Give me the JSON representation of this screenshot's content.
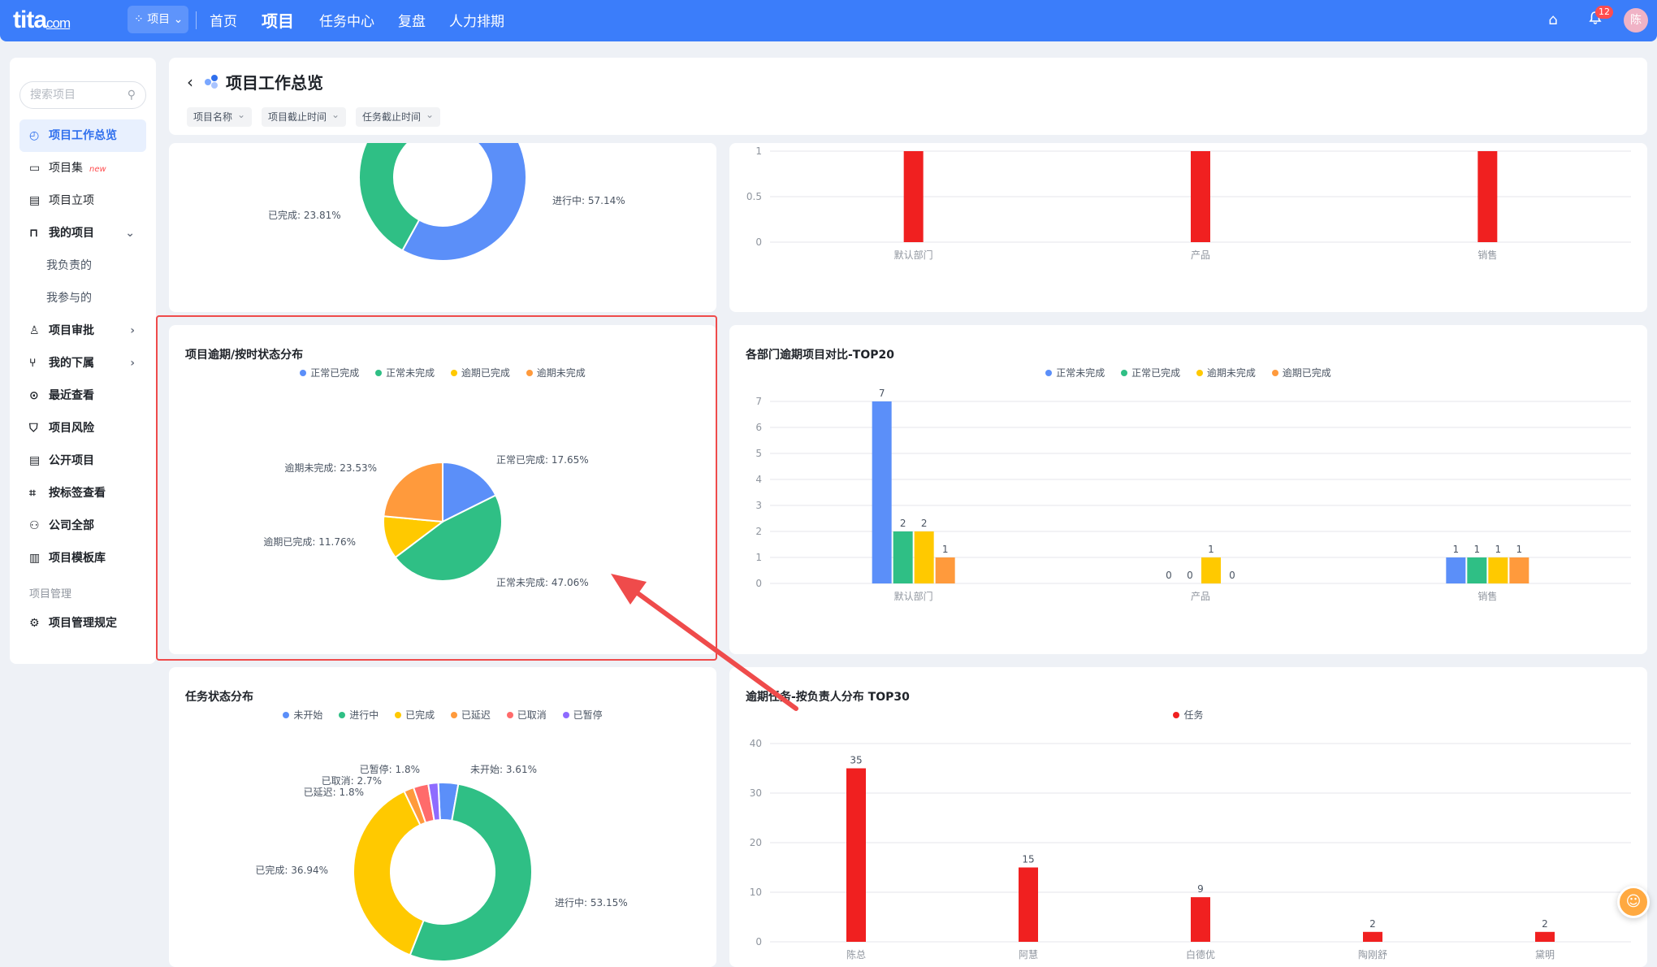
{
  "topbar": {
    "logo": "tita",
    "logo_suffix": "com",
    "project_switch": "项目",
    "nav": [
      "首页",
      "项目",
      "任务中心",
      "复盘",
      "人力排期"
    ],
    "notification_count": "12",
    "avatar": "陈"
  },
  "sidebar": {
    "search_placeholder": "搜索项目",
    "items": {
      "overview": "项目工作总览",
      "collection": "项目集",
      "collection_tag": "new",
      "initiate": "项目立项",
      "mine": "我的项目",
      "mine_owned": "我负责的",
      "mine_joined": "我参与的",
      "approval": "项目审批",
      "subordinates": "我的下属",
      "recent": "最近查看",
      "risk": "项目风险",
      "public": "公开项目",
      "by_tag": "按标签查看",
      "company": "公司全部",
      "templates": "项目模板库",
      "group_manage": "项目管理",
      "rules": "项目管理规定"
    }
  },
  "header": {
    "title": "项目工作总览",
    "filters": [
      "项目名称",
      "项目截止时间",
      "任务截止时间"
    ]
  },
  "chart_data": [
    {
      "type": "pie",
      "variant": "donut",
      "title": "",
      "slice_labels": [
        "已完成: 23.81%",
        "进行中: 57.14%"
      ],
      "note": "partially scrolled out of view"
    },
    {
      "type": "bar",
      "title": "",
      "categories": [
        "默认部门",
        "产品",
        "销售"
      ],
      "values": [
        1,
        1,
        1
      ],
      "ylim": [
        0,
        1
      ],
      "yticks": [
        "0",
        "0.5",
        "1"
      ],
      "color": "#f02020"
    },
    {
      "type": "pie",
      "title": "项目逾期/按时状态分布",
      "legend": [
        "正常已完成",
        "正常未完成",
        "逾期已完成",
        "逾期未完成"
      ],
      "colors": [
        "#5b8ff9",
        "#2fbf85",
        "#ffc900",
        "#ff9a3c"
      ],
      "values": [
        17.65,
        47.06,
        11.76,
        23.53
      ],
      "labels": [
        "正常已完成: 17.65%",
        "正常未完成: 47.06%",
        "逾期已完成: 11.76%",
        "逾期未完成: 23.53%"
      ]
    },
    {
      "type": "bar",
      "title": "各部门逾期项目对比-TOP20",
      "categories": [
        "默认部门",
        "产品",
        "销售"
      ],
      "series": [
        {
          "name": "正常未完成",
          "values": [
            7,
            0,
            1
          ],
          "color": "#5b8ff9"
        },
        {
          "name": "正常已完成",
          "values": [
            2,
            0,
            1
          ],
          "color": "#2fbf85"
        },
        {
          "name": "逾期未完成",
          "values": [
            2,
            1,
            1
          ],
          "color": "#ffc900"
        },
        {
          "name": "逾期已完成",
          "values": [
            1,
            0,
            1
          ],
          "color": "#ff9a3c"
        }
      ],
      "ylim": [
        0,
        7
      ],
      "yticks": [
        "0",
        "1",
        "2",
        "3",
        "4",
        "5",
        "6",
        "7"
      ]
    },
    {
      "type": "pie",
      "variant": "donut",
      "title": "任务状态分布",
      "legend": [
        "未开始",
        "进行中",
        "已完成",
        "已延迟",
        "已取消",
        "已暂停"
      ],
      "colors": [
        "#5b8ff9",
        "#2fbf85",
        "#ffc900",
        "#ff9a3c",
        "#ff6b6b",
        "#8e6bff"
      ],
      "values": [
        3.61,
        53.15,
        36.94,
        1.8,
        2.7,
        1.8
      ],
      "labels": [
        "未开始: 3.61%",
        "进行中: 53.15%",
        "已完成: 36.94%",
        "已延迟: 1.8%",
        "已取消: 2.7%",
        "已暂停: 1.8%"
      ]
    },
    {
      "type": "bar",
      "title": "逾期任务-按负责人分布 TOP30",
      "legend": [
        "任务"
      ],
      "categories": [
        "陈总",
        "阿慧",
        "白德优",
        "陶刚舒",
        "黛明"
      ],
      "values": [
        35,
        15,
        9,
        2,
        2
      ],
      "ylim": [
        0,
        40
      ],
      "yticks": [
        "0",
        "10",
        "20",
        "30",
        "40"
      ],
      "color": "#f02020"
    }
  ]
}
